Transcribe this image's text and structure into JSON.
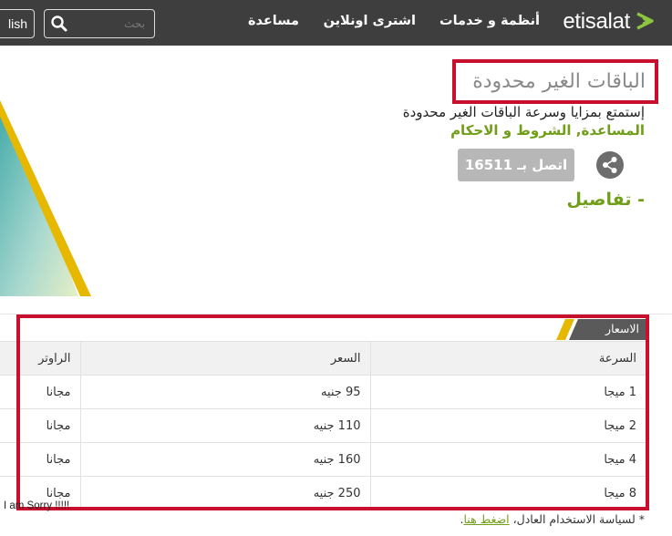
{
  "header": {
    "language_label": "lish",
    "search_placeholder": "بحث",
    "nav": [
      "مساعدة",
      "اشترى اونلاين",
      "أنظمة و خدمات"
    ],
    "logo_text": "etisalat"
  },
  "hero": {
    "title": "الباقات الغير محدودة",
    "description": "إستمتع بمزايا وسرعة الباقات الغير محدودة",
    "links_text": "المساعدة, الشروط و الاحكام",
    "call_button": "اتصل بـ 16511",
    "details_link": "- تفاصيل"
  },
  "prices": {
    "tab_label": "الاسعار",
    "columns": [
      "السرعة",
      "السعر",
      "الراوتر"
    ],
    "rows": [
      [
        "1 ميجا",
        "95 جنيه",
        "مجانا"
      ],
      [
        "2 ميجا",
        "110 جنيه",
        "مجانا"
      ],
      [
        "4 ميجا",
        "160 جنيه",
        "مجانا"
      ],
      [
        "8 ميجا",
        "250 جنيه",
        "مجانا"
      ]
    ]
  },
  "footer": {
    "overlay_text": "I am Sorry !!!!!",
    "policy_text": "* لسياسة الاستخدام العادل، ",
    "policy_link": "اضغط هنا",
    "policy_end": "."
  },
  "colors": {
    "header_bg": "#3e3e3e",
    "brand_green": "#719e19",
    "highlight_red": "#c8102e",
    "accent_yellow": "#e6b800"
  }
}
